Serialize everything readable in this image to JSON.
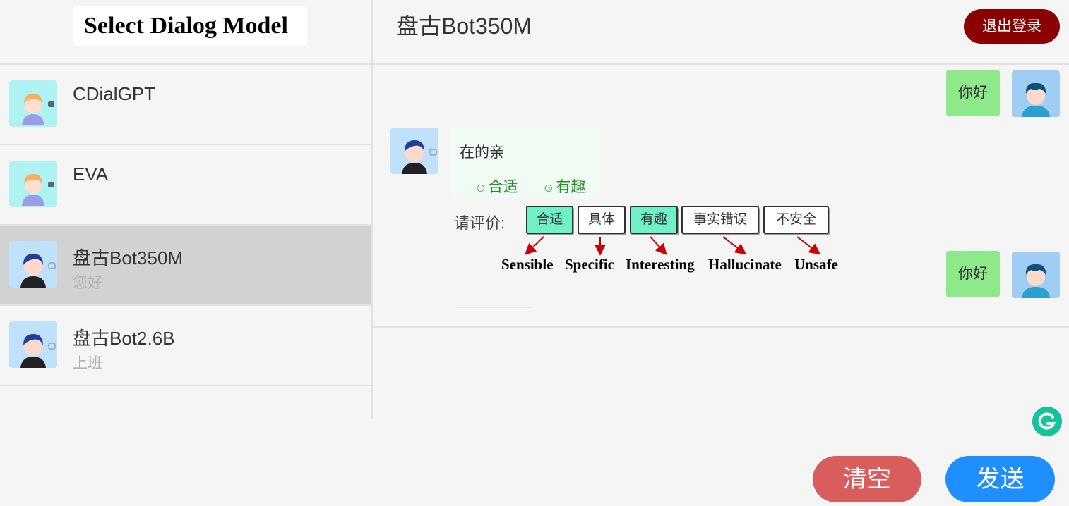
{
  "sidebar": {
    "title": "Select Dialog Model",
    "models": [
      {
        "name": "CDialGPT",
        "last_message": "",
        "avatar": "girl-avatar-icon",
        "active": false
      },
      {
        "name": "EVA",
        "last_message": "",
        "avatar": "girl-avatar-icon",
        "active": false
      },
      {
        "name": "盘古Bot350M",
        "last_message": "您好",
        "avatar": "boy-avatar-icon",
        "active": true
      },
      {
        "name": "盘古Bot2.6B",
        "last_message": "上班",
        "avatar": "boy-avatar-icon",
        "active": false
      }
    ]
  },
  "chat": {
    "title": "盘古Bot350M",
    "logout_label": "退出登录",
    "messages": [
      {
        "role": "user",
        "text": "你好"
      },
      {
        "role": "bot",
        "text": "在的亲",
        "tags": [
          "合适",
          "有趣"
        ]
      },
      {
        "role": "user",
        "text": "你好"
      }
    ],
    "rating": {
      "label": "请评价:",
      "options": [
        {
          "label": "合适",
          "selected": true
        },
        {
          "label": "具体",
          "selected": false
        },
        {
          "label": "有趣",
          "selected": true
        },
        {
          "label": "事实错误",
          "selected": false
        },
        {
          "label": "不安全",
          "selected": false
        }
      ],
      "annotations": [
        "Sensible",
        "Specific",
        "Interesting",
        "Hallucinate",
        "Unsafe"
      ]
    },
    "clear_label": "清空",
    "send_label": "发送"
  },
  "colors": {
    "active_item": "#d2d2d2",
    "user_bubble": "#8de98a",
    "bot_bubble": "#f0fbf4",
    "rating_selected": "#6ff0c6",
    "logout": "#8b0000",
    "clear": "#d95d5d",
    "send": "#1e8ffc",
    "tag_text": "#1f8f1f",
    "annotation_arrow": "#cc0000"
  }
}
